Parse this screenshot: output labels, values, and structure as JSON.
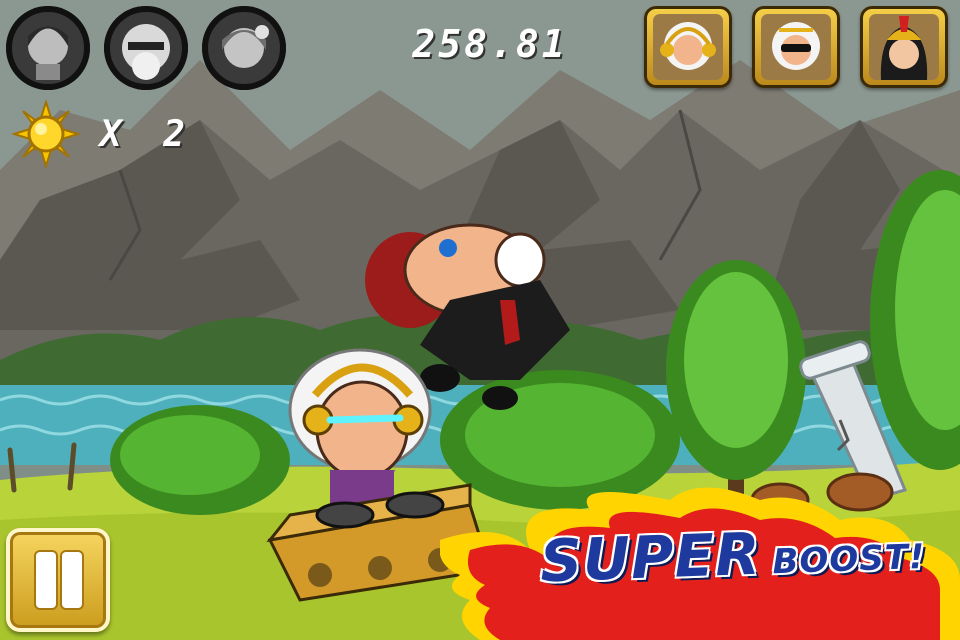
{
  "hud": {
    "distance": "258.81",
    "sun_multiplier": "X 2",
    "locked_characters": [
      {
        "name": "girl-with-hair-band",
        "icon": "locked-character-portrait"
      },
      {
        "name": "old-man-eyepatch",
        "icon": "locked-character-portrait"
      },
      {
        "name": "girl-with-flower",
        "icon": "locked-character-portrait"
      }
    ],
    "unlocked_characters": [
      {
        "name": "dj-zeus",
        "icon": "zeus-headphones-portrait"
      },
      {
        "name": "cool-zeus",
        "icon": "zeus-sunglasses-portrait"
      },
      {
        "name": "athena",
        "icon": "athena-helmet-portrait"
      }
    ]
  },
  "banner": {
    "word_1": "SUPER",
    "word_2": "BOOST!"
  },
  "icons": {
    "sun": "sun-icon",
    "pause": "pause-icon"
  },
  "colors": {
    "hud_text": "#ffffff",
    "gold_frame": "#f2c53a",
    "boost_text": "#1e3a9e",
    "flame_red": "#e3201b",
    "flame_yellow": "#ffd400",
    "grass": "#b9d33a",
    "sea": "#4fb0bd",
    "mountain": "#6a6761"
  }
}
